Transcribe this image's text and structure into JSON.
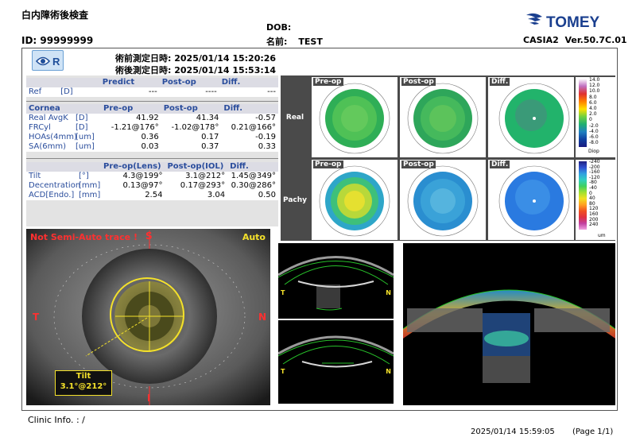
{
  "header": {
    "title": "白内障術後検査",
    "dob_label": "DOB:",
    "id_label": "ID:",
    "id_value": "99999999",
    "name_label": "名前:",
    "name_value": "TEST",
    "brand": "TOMEY",
    "device": "CASIA2",
    "version": "Ver.50.7C.01"
  },
  "measurement": {
    "pre_label": "術前測定日時:",
    "pre_value": "2025/01/14 15:20:26",
    "post_label": "術後測定日時:",
    "post_value": "2025/01/14 15:53:14",
    "eye": "R"
  },
  "ref": {
    "headers": [
      "Predict",
      "Post-op",
      "Diff."
    ],
    "label": "Ref",
    "unit": "[D]",
    "values": [
      "---",
      "----",
      "---"
    ]
  },
  "cornea": {
    "headers": [
      "Cornea",
      "Pre-op",
      "Post-op",
      "Diff."
    ],
    "rows": [
      {
        "label": "Real AvgK",
        "unit": "[D]",
        "pre": "41.92",
        "post": "41.34",
        "diff": "-0.57"
      },
      {
        "label": "FRCyl",
        "unit": "[D]",
        "pre": "-1.21@176°",
        "post": "-1.02@178°",
        "diff": "0.21@166°"
      },
      {
        "label": "HOAs(4mm)",
        "unit": "[um]",
        "pre": "0.36",
        "post": "0.17",
        "diff": "-0.19"
      },
      {
        "label": "SA(6mm)",
        "unit": "[um]",
        "pre": "0.03",
        "post": "0.37",
        "diff": "0.33"
      }
    ]
  },
  "lens": {
    "headers": [
      "Pre-op(Lens)",
      "Post-op(IOL)",
      "Diff."
    ],
    "rows": [
      {
        "label": "Tilt",
        "unit": "[°]",
        "pre": "4.3@199°",
        "post": "3.1@212°",
        "diff": "1.45@349°"
      },
      {
        "label": "Decentration",
        "unit": "[mm]",
        "pre": "0.13@97°",
        "post": "0.17@293°",
        "diff": "0.30@286°"
      },
      {
        "label": "ACD[Endo.]",
        "unit": "[mm]",
        "pre": "2.54",
        "post": "3.04",
        "diff": "0.50"
      }
    ]
  },
  "maps": {
    "row1_label": "Real",
    "row2_label": "Pachy",
    "col_labels": [
      "Pre-op",
      "Post-op",
      "Diff."
    ],
    "scale1": [
      "14.0",
      "12.0",
      "10.0",
      "8.0",
      "6.0",
      "4.0",
      "2.0",
      "0",
      "-2.0",
      "-4.0",
      "-6.0",
      "-8.0"
    ],
    "scale1_unit": "Diop",
    "scale2": [
      "-240",
      "-200",
      "-160",
      "-120",
      "-80",
      "-40",
      "0",
      "40",
      "80",
      "120",
      "160",
      "200",
      "240"
    ],
    "scale2_unit": "um"
  },
  "photo": {
    "warning": "Not Semi-Auto trace !",
    "mode": "Auto",
    "top": "S",
    "bottom": "I",
    "left": "T",
    "right": "N",
    "tilt_label": "Tilt",
    "tilt_value": "3.1°@212°"
  },
  "oct": {
    "left_label": "T",
    "right_label": "N"
  },
  "footer": {
    "clinic": "Clinic Info. :   /",
    "timestamp": "2025/01/14 15:59:05",
    "page": "(Page 1/1)"
  }
}
